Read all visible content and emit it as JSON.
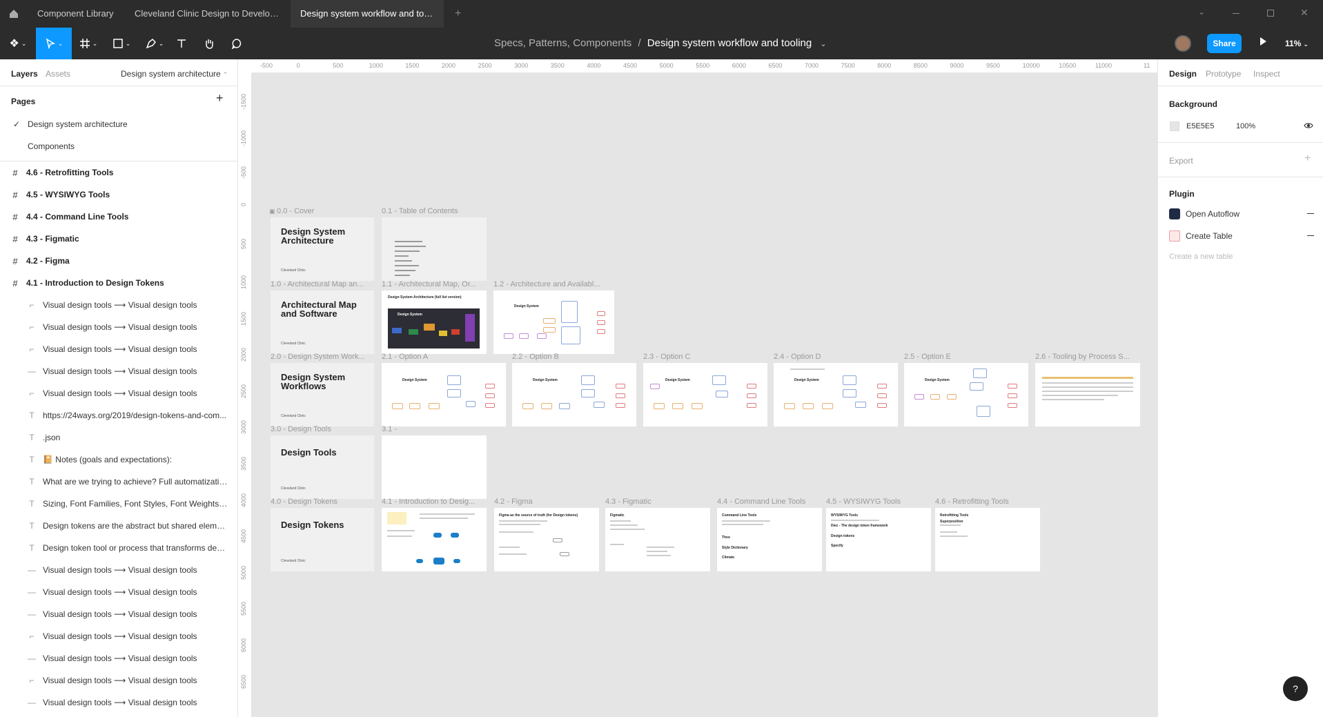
{
  "tabs": [
    "Component Library",
    "Cleveland Clinic Design to Develop...",
    "Design system workflow and tooling"
  ],
  "toolbar": {
    "breadcrumb_parent": "Specs, Patterns, Components",
    "breadcrumb_sep": "/",
    "file_name": "Design system workflow and tooling",
    "share_label": "Share",
    "zoom": "11%"
  },
  "left": {
    "tab_layers": "Layers",
    "tab_assets": "Assets",
    "current_page": "Design system architecture",
    "pages_title": "Pages",
    "pages": [
      "Design system architecture",
      "Components"
    ],
    "layers": [
      {
        "icon": "#",
        "label": "4.6 - Retrofitting Tools",
        "frame": true
      },
      {
        "icon": "#",
        "label": "4.5 - WYSIWYG Tools",
        "frame": true
      },
      {
        "icon": "#",
        "label": "4.4 - Command Line Tools",
        "frame": true
      },
      {
        "icon": "#",
        "label": "4.3 - Figmatic",
        "frame": true
      },
      {
        "icon": "#",
        "label": "4.2 - Figma",
        "frame": true
      },
      {
        "icon": "#",
        "label": "4.1 - Introduction to Design Tokens",
        "frame": true
      },
      {
        "icon": "⌐",
        "label": "Visual design tools ⟶ Visual design tools"
      },
      {
        "icon": "⌐",
        "label": "Visual design tools ⟶ Visual design tools"
      },
      {
        "icon": "⌐",
        "label": "Visual design tools ⟶ Visual design tools"
      },
      {
        "icon": "—",
        "label": "Visual design tools ⟶ Visual design tools"
      },
      {
        "icon": "⌐",
        "label": "Visual design tools ⟶ Visual design tools"
      },
      {
        "icon": "T",
        "label": "https://24ways.org/2019/design-tokens-and-com..."
      },
      {
        "icon": "T",
        "label": ".json"
      },
      {
        "icon": "T",
        "label": "📔 Notes (goals and expectations):"
      },
      {
        "icon": "T",
        "label": "What are we trying to achieve? Full automatizatio..."
      },
      {
        "icon": "T",
        "label": "Sizing, Font Families, Font Styles, Font Weights, F..."
      },
      {
        "icon": "T",
        "label": "Design tokens are the abstract but shared elemen..."
      },
      {
        "icon": "T",
        "label": "Design token tool or process that transforms desi..."
      },
      {
        "icon": "—",
        "label": "Visual design tools ⟶ Visual design tools"
      },
      {
        "icon": "—",
        "label": "Visual design tools ⟶ Visual design tools"
      },
      {
        "icon": "—",
        "label": "Visual design tools ⟶ Visual design tools"
      },
      {
        "icon": "⌐",
        "label": "Visual design tools ⟶ Visual design tools"
      },
      {
        "icon": "—",
        "label": "Visual design tools ⟶ Visual design tools"
      },
      {
        "icon": "⌐",
        "label": "Visual design tools ⟶ Visual design tools"
      },
      {
        "icon": "—",
        "label": "Visual design tools ⟶ Visual design tools"
      }
    ]
  },
  "right": {
    "tab_design": "Design",
    "tab_prototype": "Prototype",
    "tab_inspect": "Inspect",
    "bg_title": "Background",
    "bg_hex": "E5E5E5",
    "bg_opacity": "100%",
    "export_title": "Export",
    "plugin_title": "Plugin",
    "plugins": [
      "Open Autoflow",
      "Create Table"
    ],
    "plugin_hint": "Create a new table",
    "bg_color": "#E5E5E5"
  },
  "rulers": {
    "h": [
      "-500",
      "0",
      "500",
      "1000",
      "1500",
      "2000",
      "2500",
      "3000",
      "3500",
      "4000",
      "4500",
      "5000",
      "5500",
      "6000",
      "6500",
      "7000",
      "7500",
      "8000",
      "8500",
      "9000",
      "9500",
      "10000",
      "10500",
      "11000",
      "11"
    ],
    "v": [
      "-1500",
      "-1000",
      "-500",
      "0",
      "500",
      "1000",
      "1500",
      "2000",
      "2500",
      "3000",
      "3500",
      "4000",
      "4500",
      "5000",
      "5500",
      "6000",
      "6500"
    ]
  },
  "frames": {
    "cover": {
      "label": "0.0 - Cover",
      "title": "Design System Architecture",
      "org": "Cleveland Clinic"
    },
    "toc": {
      "label": "0.1 - Table of Contents"
    },
    "arch": {
      "label": "1.0 - Architectural Map an...",
      "title": "Architectural Map and Software",
      "org": "Cleveland Clinic"
    },
    "arch1": {
      "label": "1.1 - Architectural Map, Or...",
      "heading": "Design System Architecture (full list version)",
      "node": "Design System"
    },
    "arch2": {
      "label": "1.2 - Architecture and Availabl...",
      "node": "Design System"
    },
    "wf": {
      "label": "2.0 - Design System Work...",
      "title": "Design System Workflows",
      "org": "Cleveland Clinic"
    },
    "options": [
      {
        "label": "2.1 - Option A",
        "node": "Design System"
      },
      {
        "label": "2.2 - Option B",
        "node": "Design System"
      },
      {
        "label": "2.3 - Option C",
        "node": "Design System"
      },
      {
        "label": "2.4 - Option D",
        "node": "Design System"
      },
      {
        "label": "2.5 - Option E",
        "node": "Design System"
      }
    ],
    "tooling": {
      "label": "2.6 - Tooling by Process S..."
    },
    "tools": {
      "label": "3.0 - Design Tools",
      "title": "Design Tools",
      "org": "Cleveland Clinic"
    },
    "tools1": {
      "label": "3.1 -"
    },
    "tokens": {
      "label": "4.0 - Design Tokens",
      "title": "Design Tokens",
      "org": "Cleveland Clinic"
    },
    "intro": {
      "label": "4.1 - Introduction to Desig..."
    },
    "figma": {
      "label": "4.2 - Figma",
      "heading": "Figma as the source of truth (for Design tokens)"
    },
    "figmatic": {
      "label": "4.3 - Figmatic",
      "heading": "Figmatic"
    },
    "cli": {
      "label": "4.4 - Command Line Tools",
      "heading": "Command Line Tools",
      "s1": "Theo",
      "s2": "Style Dictionary",
      "s3": "Climate"
    },
    "wysiwyg": {
      "label": "4.5 - WYSIWYG Tools",
      "heading": "WYSIWYG Tools",
      "s1": "Diez - The design token framework",
      "s2": "Design tokens",
      "s3": "Specify"
    },
    "retro": {
      "label": "4.6 - Retrofitting Tools",
      "heading": "Retrofitting Tools",
      "s1": "Superposition"
    }
  },
  "help": "?"
}
